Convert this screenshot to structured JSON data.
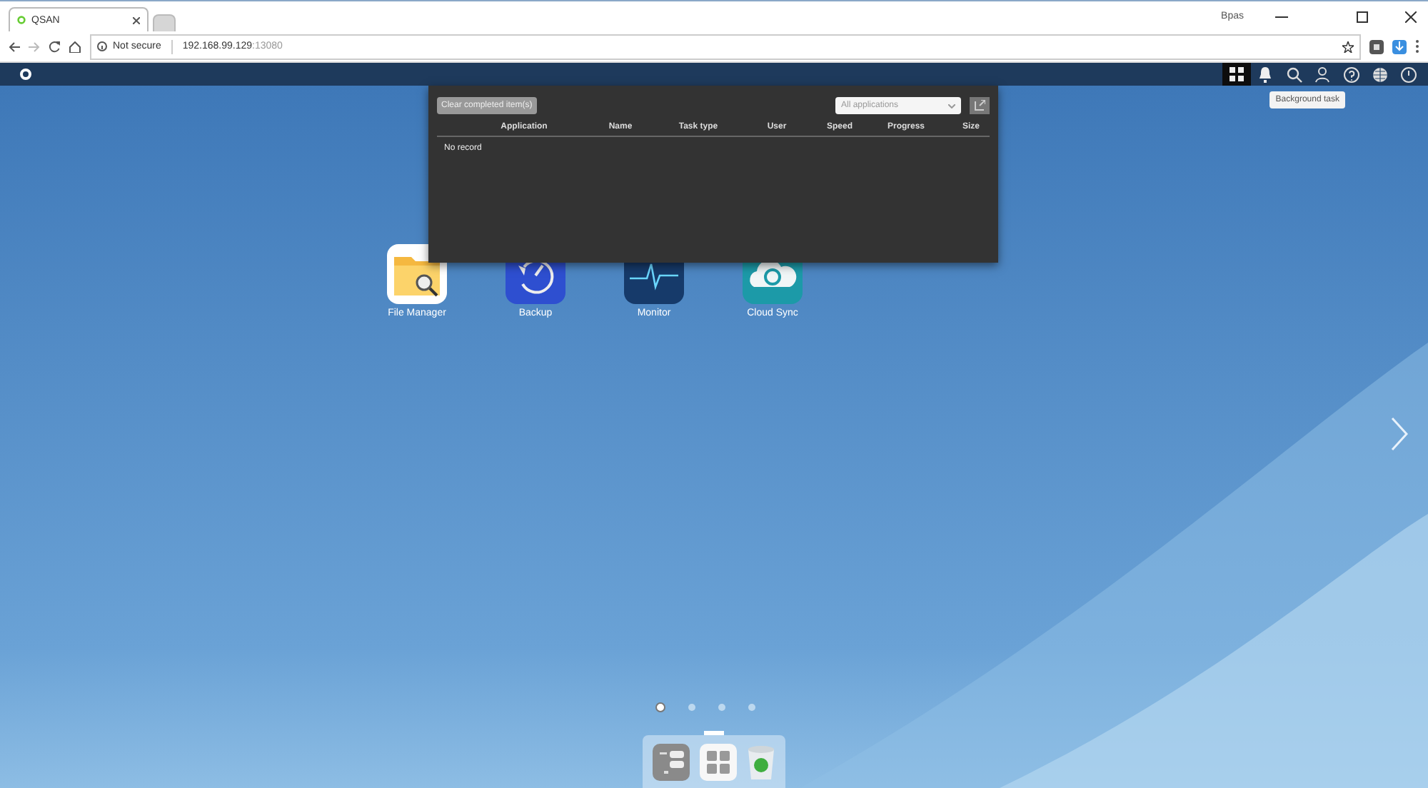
{
  "browser": {
    "tabs": [
      {
        "title": "QSAN",
        "selected": true
      }
    ],
    "profile": "Bpas",
    "security": "Not secure",
    "url_host": "192.168.99.129",
    "url_port": ":13080"
  },
  "topbar": {
    "icons": [
      {
        "kind": "apps",
        "selected": true
      },
      {
        "kind": "bell",
        "selected": false
      },
      {
        "kind": "search",
        "selected": false
      },
      {
        "kind": "user",
        "selected": false
      },
      {
        "kind": "help",
        "selected": false
      },
      {
        "kind": "globe",
        "selected": false
      },
      {
        "kind": "gauge",
        "selected": false
      }
    ],
    "tooltip": "Background task"
  },
  "task_panel": {
    "clear_button": "Clear completed item(s)",
    "filter": "All applications",
    "columns": [
      "Application",
      "Name",
      "Task type",
      "User",
      "Speed",
      "Progress",
      "Size"
    ],
    "empty_text": "No record"
  },
  "apps": [
    {
      "kind": "files",
      "label": "File Manager"
    },
    {
      "kind": "backup",
      "label": "Backup"
    },
    {
      "kind": "monitor",
      "label": "Monitor"
    },
    {
      "kind": "cloud",
      "label": "Cloud Sync"
    }
  ],
  "pages": [
    {
      "selected": true
    },
    {
      "selected": false
    },
    {
      "selected": false
    },
    {
      "selected": false
    }
  ],
  "dock": [
    {
      "kind": "storage"
    },
    {
      "kind": "apps"
    },
    {
      "kind": "trash"
    }
  ]
}
